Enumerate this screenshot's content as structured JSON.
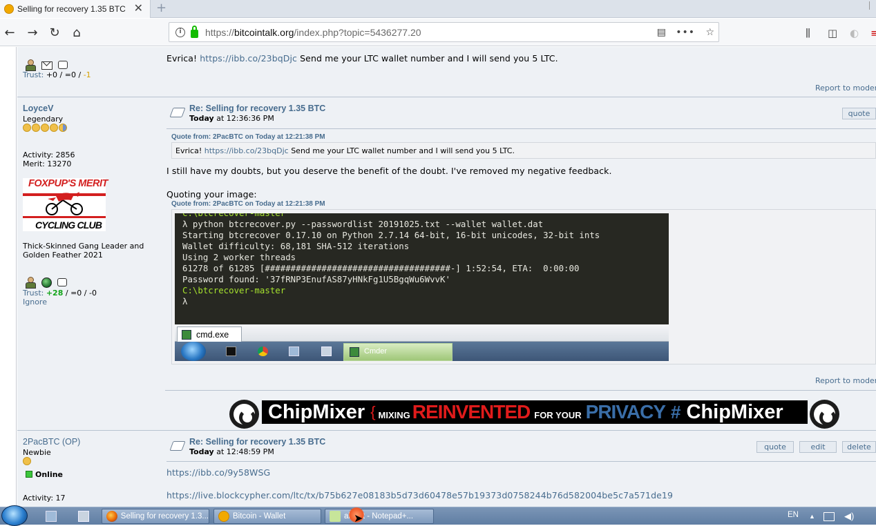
{
  "browser": {
    "tab_title": "Selling for recovery 1.35 BTC",
    "url_prefix": "https://",
    "url_domain": "bitcointalk.org",
    "url_path": "/index.php?topic=5436277.20"
  },
  "posts": {
    "prev": {
      "trust_label": "Trust: ",
      "trust_pos": "+0",
      "trust_mid": " / =0 / ",
      "trust_neg": "-1",
      "text_prefix": "Evrica! ",
      "link": "https://ibb.co/23bqDjc",
      "text_suffix": " Send me your LTC wallet number and I will send you 5 LTC.",
      "report": "Report to moderator"
    },
    "p1": {
      "user": "LoyceV",
      "rank": "Legendary",
      "activity": "Activity: 2856",
      "merit": "Merit: 13270",
      "merit_banner_top": "FOXPUP'S MERIT",
      "merit_banner_bottom": "CYCLING CLUB",
      "personal_text": "Thick-Skinned Gang Leader and Golden Feather 2021",
      "trust_label": "Trust: ",
      "trust_pos": "+28",
      "trust_rest": " / =0 / -0",
      "ignore": "Ignore",
      "subject": "Re: Selling for recovery 1.35 BTC",
      "date_bold": "Today",
      "date_rest": " at 12:36:36 PM",
      "quote_btn": "quote",
      "quote_header": "Quote from: 2PacBTC on Today at 12:21:38 PM",
      "quote_prefix": "Evrica! ",
      "quote_link": "https://ibb.co/23bqDjc",
      "quote_suffix": " Send me your LTC wallet number and I will send you 5 LTC.",
      "body1": "I still have my doubts, but you deserve the benefit of the doubt. I've removed my negative feedback.",
      "body2": "Quoting your image:",
      "quote_header2": "Quote from: 2PacBTC on Today at 12:21:38 PM",
      "terminal": {
        "l0": "C:\\btcrecover-master",
        "l1": "λ python btcrecover.py --passwordlist 20191025.txt --wallet wallet.dat",
        "l2": "Starting btcrecover 0.17.10 on Python 2.7.14 64-bit, 16-bit unicodes, 32-bit ints",
        "l3": "Wallet difficulty: 68,181 SHA-512 iterations",
        "l4": "Using 2 worker threads",
        "l5": "61278 of 61285 [####################################-] 1:52:54, ETA:  0:00:00",
        "l6": "Password found: '37fRNP3EnufAS87yHNkFg1U5BgqWu6WvvK'",
        "l7": "",
        "l8": "C:\\btcrecover-master",
        "l9": "λ"
      },
      "cmd_tab": "cmd.exe",
      "cmd_taskbar_active": "Cmder",
      "report": "Report to moderator"
    },
    "banner": {
      "w1": "ChipMixer",
      "brace": "{",
      "s1": "MIXING",
      "red": "REINVENTED",
      "s2": "FOR YOUR",
      "blue": "PRIVACY",
      "hash": "#",
      "w2": "ChipMixer"
    },
    "p2": {
      "user": "2PacBTC (OP)",
      "rank": "Newbie",
      "online": "Online",
      "activity": "Activity: 17",
      "subject": "Re: Selling for recovery 1.35 BTC",
      "date_bold": "Today",
      "date_rest": " at 12:48:59 PM",
      "quote_btn": "quote",
      "edit_btn": "edit",
      "delete_btn": "delete",
      "link1": "https://ibb.co/9y58WSG",
      "link2": "https://live.blockcypher.com/ltc/tx/b75b627e08183b5d73d60478e57b19373d0758244b76d582004be5c7a571de19"
    }
  },
  "taskbar": {
    "item1": "Selling for recovery 1.3...",
    "item2": "Bitcoin - Wallet",
    "item3": "als.txt - Notepad+...",
    "lang": "EN"
  },
  "colors": {
    "link": "#476c8e",
    "post_bg": "#eef1f5",
    "terminal_bg": "#272822"
  }
}
